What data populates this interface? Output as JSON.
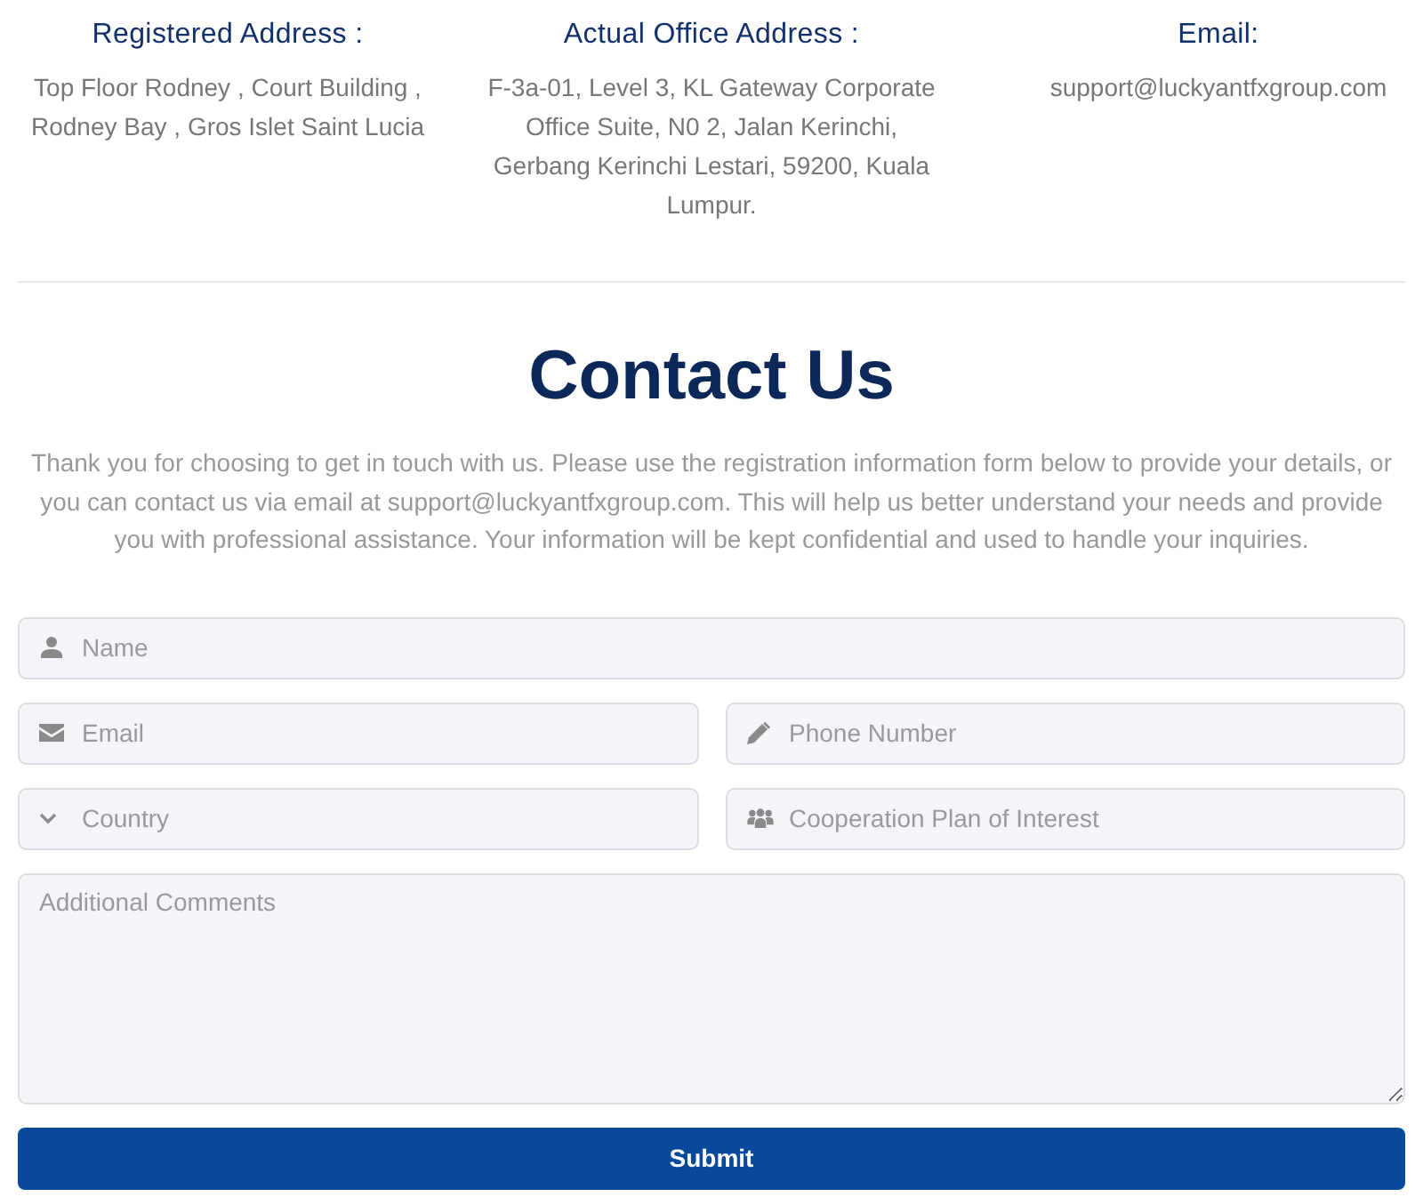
{
  "addresses": [
    {
      "heading": "Registered Address :",
      "text": "Top Floor Rodney , Court Building , Rodney Bay , Gros Islet Saint Lucia"
    },
    {
      "heading": "Actual Office Address :",
      "text": "F-3a-01, Level 3, KL Gateway Corporate Office Suite, N0 2, Jalan Kerinchi, Gerbang Kerinchi Lestari, 59200, Kuala Lumpur."
    },
    {
      "heading": "Email:",
      "text": "support@luckyantfxgroup.com"
    }
  ],
  "contact": {
    "title": "Contact Us",
    "intro": "Thank you for choosing to get in touch with us. Please use the registration information form below to provide your details, or you can contact us via email at support@luckyantfxgroup.com. This will help us better understand your needs and provide you with professional assistance. Your information will be kept confidential and used to handle your inquiries."
  },
  "form": {
    "rows": [
      [
        {
          "kind": "name",
          "placeholder": "Name"
        }
      ],
      [
        {
          "kind": "email",
          "placeholder": "Email"
        },
        {
          "kind": "phone",
          "placeholder": "Phone Number"
        }
      ],
      [
        {
          "kind": "country",
          "placeholder": "Country"
        },
        {
          "kind": "plan",
          "placeholder": "Cooperation Plan of Interest"
        }
      ]
    ],
    "comments": {
      "placeholder": "Additional Comments"
    },
    "submit": "Submit"
  }
}
